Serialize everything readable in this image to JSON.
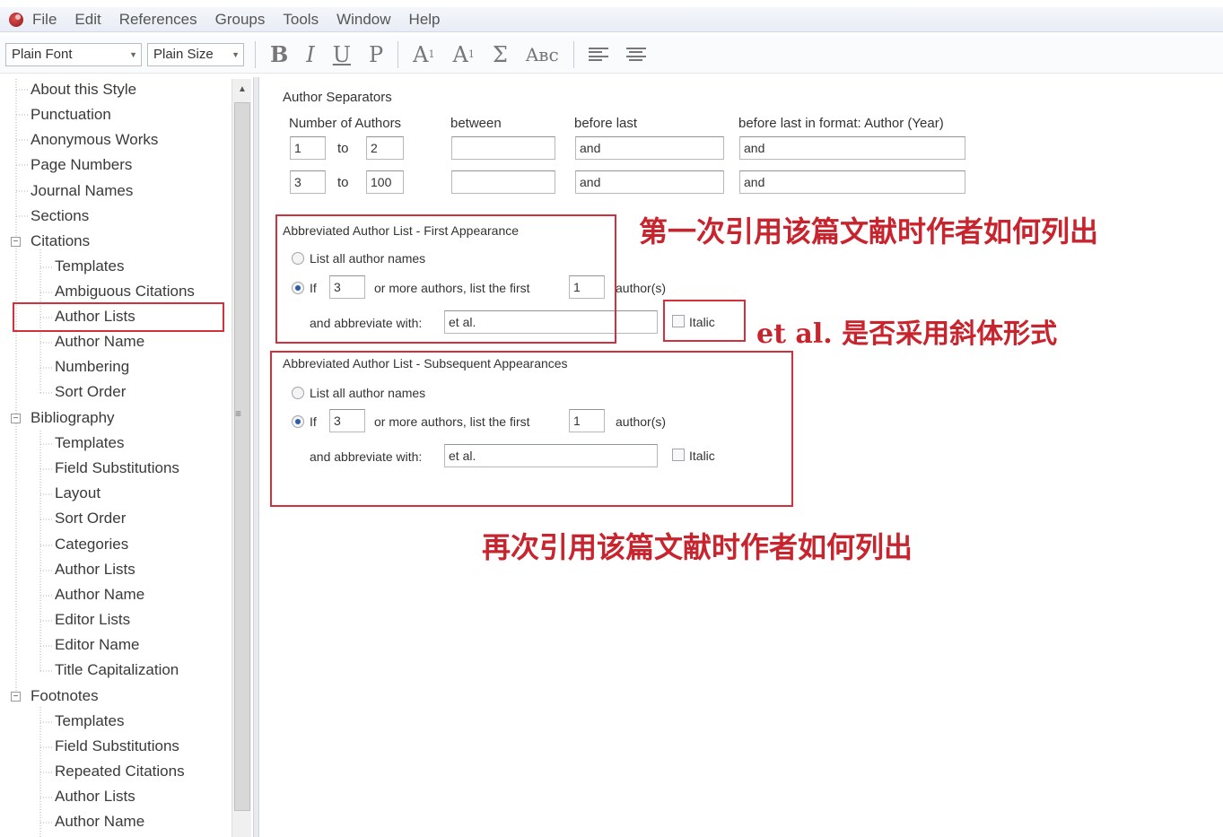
{
  "menu": [
    "File",
    "Edit",
    "References",
    "Groups",
    "Tools",
    "Window",
    "Help"
  ],
  "toolbar": {
    "font_select": "Plain Font",
    "size_select": "Plain Size",
    "bold": "B",
    "italic": "I",
    "underline": "U",
    "plain": "P",
    "superscript": "A",
    "subscript": "A",
    "symbol": "Σ",
    "small_caps": "Aʙc"
  },
  "tree": {
    "about": "About this Style",
    "punctuation": "Punctuation",
    "anonymous": "Anonymous Works",
    "page_numbers": "Page Numbers",
    "journal_names": "Journal Names",
    "sections": "Sections",
    "citations": "Citations",
    "cit_templates": "Templates",
    "cit_ambiguous": "Ambiguous Citations",
    "cit_author_lists": "Author Lists",
    "cit_author_name": "Author Name",
    "cit_numbering": "Numbering",
    "cit_sort_order": "Sort Order",
    "bibliography": "Bibliography",
    "bib_templates": "Templates",
    "bib_field_subs": "Field Substitutions",
    "bib_layout": "Layout",
    "bib_sort_order": "Sort Order",
    "bib_categories": "Categories",
    "bib_author_lists": "Author Lists",
    "bib_author_name": "Author Name",
    "bib_editor_lists": "Editor Lists",
    "bib_editor_name": "Editor Name",
    "bib_title_cap": "Title Capitalization",
    "footnotes": "Footnotes",
    "fn_templates": "Templates",
    "fn_field_subs": "Field Substitutions",
    "fn_repeated": "Repeated Citations",
    "fn_author_lists": "Author Lists",
    "fn_author_name": "Author Name"
  },
  "separators": {
    "title": "Author Separators",
    "col_number": "Number of Authors",
    "col_between": "between",
    "col_before_last": "before last",
    "col_before_last_format": "before last in format: Author (Year)",
    "to": "to",
    "row1": {
      "from": "1",
      "to": "2",
      "between": "",
      "before_last": "and",
      "before_last_format": "and"
    },
    "row2": {
      "from": "3",
      "to": "100",
      "between": "",
      "before_last": "and",
      "before_last_format": "and"
    }
  },
  "first_appearance": {
    "title": "Abbreviated Author List - First Appearance",
    "list_all": "List all author names",
    "if_label": "If",
    "min_authors": "3",
    "or_more": "or more authors, list the first",
    "list_first": "1",
    "authors_suffix": "author(s)",
    "abbrev_label": "and abbreviate with:",
    "abbrev_value": "et al.",
    "italic_label": "Italic"
  },
  "subsequent": {
    "title": "Abbreviated Author List - Subsequent Appearances",
    "list_all": "List all author names",
    "if_label": "If",
    "min_authors": "3",
    "or_more": "or more authors, list the first",
    "list_first": "1",
    "authors_suffix": "author(s)",
    "abbrev_label": "and abbreviate with:",
    "abbrev_value": "et al.",
    "italic_label": "Italic"
  },
  "annotations": {
    "first": "第一次引用该篇文献时作者如何列出",
    "italic": "et al. 是否采用斜体形式",
    "subsequent": "再次引用该篇文献时作者如何列出"
  },
  "colors": {
    "annotation_red": "#d0313b",
    "radio_selected": "#2a5cab"
  }
}
